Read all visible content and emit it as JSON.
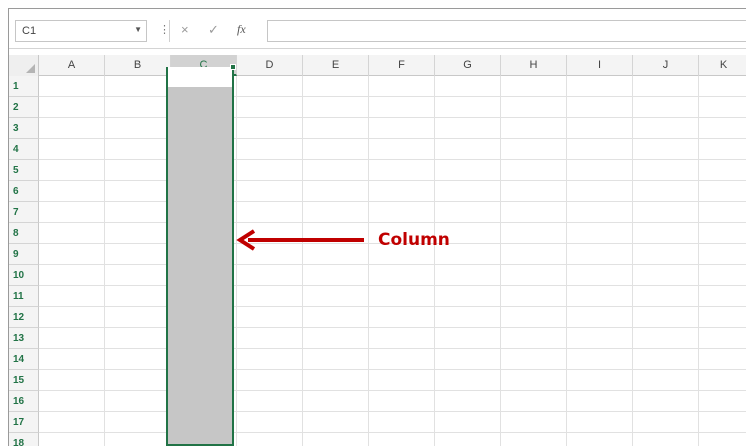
{
  "formula_bar": {
    "name_box": "C1",
    "separator": "⋮",
    "cancel_icon": "×",
    "enter_icon": "✓",
    "fx_label": "fx",
    "formula_value": ""
  },
  "columns": [
    "A",
    "B",
    "C",
    "D",
    "E",
    "F",
    "G",
    "H",
    "I",
    "J",
    "K"
  ],
  "selected_column": "C",
  "rows": [
    "1",
    "2",
    "3",
    "4",
    "5",
    "6",
    "7",
    "8",
    "9",
    "10",
    "11",
    "12",
    "13",
    "14",
    "15",
    "16",
    "17",
    "18"
  ],
  "annotation": {
    "label": "Column",
    "color": "#c00000"
  },
  "colors": {
    "accent": "#217346",
    "selection_fill": "#c6c6c6"
  }
}
